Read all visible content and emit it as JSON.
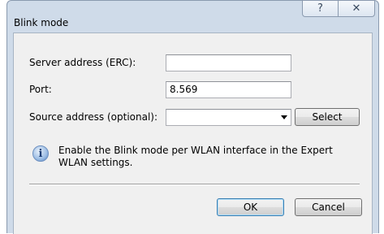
{
  "window": {
    "title": "Blink mode",
    "help_glyph": "?",
    "close_glyph": "✕"
  },
  "form": {
    "server_label": "Server address (ERC):",
    "server_value": "",
    "port_label": "Port:",
    "port_value": "8.569",
    "source_label": "Source address (optional):",
    "source_value": "",
    "select_label": "Select"
  },
  "info": {
    "icon": "info-icon",
    "icon_glyph": "i",
    "line1": "Enable the Blink mode per WLAN interface in the Expert",
    "line2": "WLAN settings."
  },
  "footer": {
    "ok_label": "OK",
    "cancel_label": "Cancel"
  }
}
